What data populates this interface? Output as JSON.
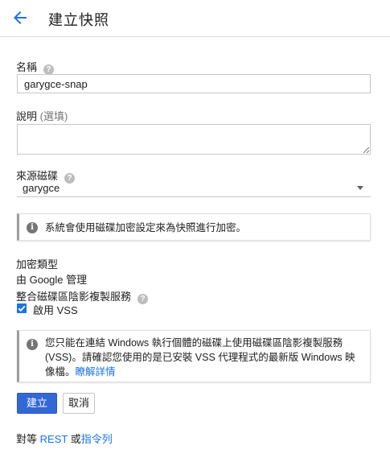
{
  "header": {
    "title": "建立快照",
    "back_icon": "arrow-back-icon"
  },
  "name": {
    "label": "名稱",
    "value": "garygce-snap",
    "help_icon": "?"
  },
  "description": {
    "label": "說明",
    "optional": "(選填)",
    "value": ""
  },
  "source_disk": {
    "label": "來源磁碟",
    "value": "garygce",
    "help_icon": "?"
  },
  "info_encryption": {
    "text": "系統會使用磁碟加密設定來為快照進行加密。"
  },
  "encryption": {
    "label": "加密類型",
    "value": "由 Google 管理"
  },
  "vss": {
    "label": "整合磁碟區陰影複製服務",
    "help_icon": "?",
    "checkbox_label": "啟用 VSS",
    "checked": true
  },
  "info_vss": {
    "text": "您只能在連結 Windows 執行個體的磁碟上使用磁碟區陰影複製服務 (VSS)。請確認您使用的是已安裝 VSS 代理程式的最新版 Windows 映像檔。",
    "link": "瞭解詳情"
  },
  "actions": {
    "create": "建立",
    "cancel": "取消"
  },
  "footer": {
    "prefix": "對等",
    "rest": "REST",
    "or": "或",
    "cli": "指令列"
  },
  "colors": {
    "accent": "#1a73e8",
    "primary_button": "#3367d6",
    "info_bar": "#9e9e9e"
  }
}
